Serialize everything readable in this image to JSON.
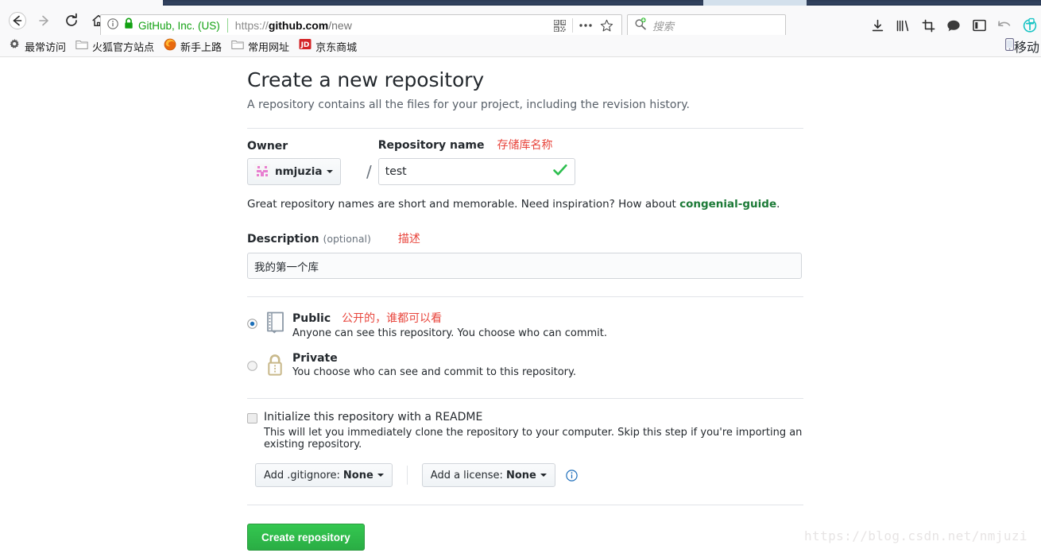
{
  "browser": {
    "nav": {
      "back_icon": "arrow-left-icon",
      "forward_icon": "arrow-right-icon",
      "reload_icon": "reload-icon",
      "home_icon": "home-icon"
    },
    "urlbar": {
      "info_icon": "info-circle-icon",
      "lock_icon": "padlock-icon",
      "site_owner": "GitHub, Inc. (US)",
      "url_scheme": "https://",
      "url_host": "github.com",
      "url_path": "/new",
      "full_url": "https://github.com/new",
      "qr_icon": "qr-code-icon",
      "page_actions_icon": "ellipsis-icon",
      "bookmark_icon": "star-icon",
      "secure_color": "#12a112"
    },
    "search": {
      "icon": "search-magnifier-icon",
      "placeholder": "搜索"
    },
    "toolbar_icons": [
      {
        "name": "downloads-icon"
      },
      {
        "name": "library-icon"
      },
      {
        "name": "screenshot-crop-icon"
      },
      {
        "name": "pocket-chat-icon"
      },
      {
        "name": "sidebar-icon"
      },
      {
        "name": "undo-arrow-icon"
      },
      {
        "name": "translate-icon"
      }
    ],
    "bookmarks": [
      {
        "icon": "gear-icon",
        "label": "最常访问"
      },
      {
        "icon": "folder-icon",
        "label": "火狐官方站点"
      },
      {
        "icon": "firefox-icon",
        "label": "新手上路"
      },
      {
        "icon": "folder-icon",
        "label": "常用网址"
      },
      {
        "icon": "jd-icon",
        "label": "京东商城"
      }
    ],
    "bookmark_overflow": {
      "icon": "mobile-icon",
      "label": "移动"
    }
  },
  "page": {
    "title": "Create a new repository",
    "subtitle": "A repository contains all the files for your project, including the revision history.",
    "owner": {
      "label": "Owner",
      "name": "nmjuzia",
      "avatar_icon": "identicon-avatar",
      "avatar_color": "#e87fd0",
      "caret_icon": "caret-down-icon"
    },
    "separator": "/",
    "repo_name": {
      "label": "Repository name",
      "annotation": "存储库名称",
      "value": "test",
      "valid_icon": "green-check-icon",
      "valid_color": "#2cbe4e"
    },
    "hint": {
      "text_before": "Great repository names are short and memorable. Need inspiration? How about ",
      "suggestion": "congenial-guide",
      "text_after": "."
    },
    "description": {
      "label": "Description",
      "optional": "(optional)",
      "annotation": "描述",
      "value": "我的第一个库"
    },
    "visibility": [
      {
        "id": "public",
        "selected": true,
        "icon": "repo-book-icon",
        "title": "Public",
        "annotation": "公开的，谁都可以看",
        "desc": "Anyone can see this repository. You choose who can commit."
      },
      {
        "id": "private",
        "selected": false,
        "icon": "lock-icon",
        "title": "Private",
        "annotation": "",
        "desc": "You choose who can see and commit to this repository."
      }
    ],
    "readme": {
      "checked": false,
      "title": "Initialize this repository with a README",
      "desc": "This will let you immediately clone the repository to your computer. Skip this step if you're importing an existing repository."
    },
    "gitignore": {
      "label": "Add .gitignore:",
      "value": "None",
      "caret_icon": "caret-down-icon"
    },
    "license": {
      "label": "Add a license:",
      "value": "None",
      "caret_icon": "caret-down-icon"
    },
    "license_info_icon": "info-circle-icon",
    "submit": {
      "label": "Create repository",
      "color": "#2cbe4e"
    },
    "watermark": "https://blog.csdn.net/nmjuzi"
  }
}
